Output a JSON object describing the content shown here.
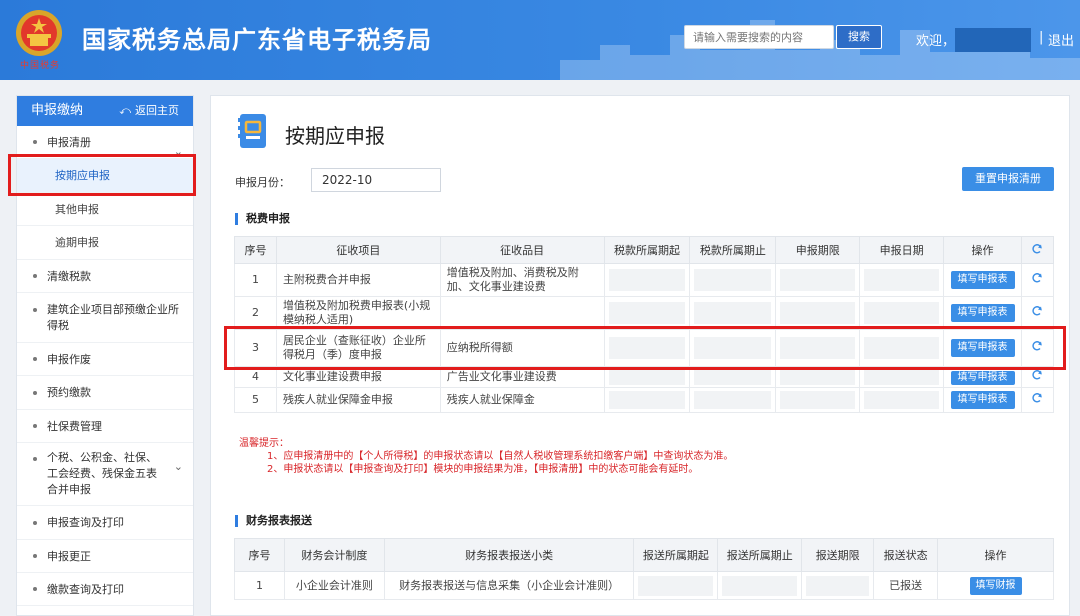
{
  "header": {
    "site_title": "国家税务总局广东省电子税务局",
    "emblem_caption": "中国税务",
    "search_placeholder": "请输入需要搜索的内容",
    "search_button": "搜索",
    "welcome": "欢迎，",
    "separator": "|",
    "logout": "退出",
    "brand_color": "#2f7de0"
  },
  "sidebar": {
    "title": "申报缴纳",
    "back_home": "返回主页",
    "items": [
      {
        "label": "申报清册",
        "expandable": true,
        "sub": [
          {
            "label": "按期应申报",
            "active": true
          },
          {
            "label": "其他申报",
            "active": false
          },
          {
            "label": "逾期申报",
            "active": false
          }
        ]
      },
      {
        "label": "清缴税款"
      },
      {
        "label": "建筑企业项目部预缴企业所得税"
      },
      {
        "label": "申报作废"
      },
      {
        "label": "预约缴款"
      },
      {
        "label": "社保费管理"
      },
      {
        "label": "个税、公积金、社保、工会经费、残保金五表合并申报",
        "expandable": true
      },
      {
        "label": "申报查询及打印"
      },
      {
        "label": "申报更正"
      },
      {
        "label": "缴款查询及打印"
      }
    ]
  },
  "main": {
    "page_title": "按期应申报",
    "month_label": "申报月份：",
    "month_value": "2022-10",
    "reset_button": "重置申报清册",
    "tax_section_title": "税费申报",
    "tax_table": {
      "headers": [
        "序号",
        "征收项目",
        "征收品目",
        "税款所属期起",
        "税款所属期止",
        "申报期限",
        "申报日期",
        "操作"
      ],
      "action_label": "填写申报表",
      "rows": [
        {
          "no": "1",
          "item": "主附税费合并申报",
          "category": "增值税及附加、消费税及附加、文化事业建设费"
        },
        {
          "no": "2",
          "item": "增值税及附加税费申报表(小规模纳税人适用)",
          "category": ""
        },
        {
          "no": "3",
          "item": "居民企业（查账征收）企业所得税月（季）度申报",
          "category": "应纳税所得额"
        },
        {
          "no": "4",
          "item": "文化事业建设费申报",
          "category": "广告业文化事业建设费"
        },
        {
          "no": "5",
          "item": "残疾人就业保障金申报",
          "category": "残疾人就业保障金"
        }
      ]
    },
    "tips": {
      "heading": "温馨提示：",
      "lines": [
        "1、应申报清册中的【个人所得税】的申报状态请以【自然人税收管理系统扣缴客户端】中查询状态为准。",
        "2、申报状态请以【申报查询及打印】模块的申报结果为准，【申报清册】中的状态可能会有延时。"
      ]
    },
    "finance_section_title": "财务报表报送",
    "finance_table": {
      "headers": [
        "序号",
        "财务会计制度",
        "财务报表报送小类",
        "报送所属期起",
        "报送所属期止",
        "报送期限",
        "报送状态",
        "操作"
      ],
      "rows": [
        {
          "no": "1",
          "system": "小企业会计准则",
          "subtype": "财务报表报送与信息采集（小企业会计准则）",
          "status": "已报送",
          "action": "填写财报"
        }
      ]
    }
  }
}
